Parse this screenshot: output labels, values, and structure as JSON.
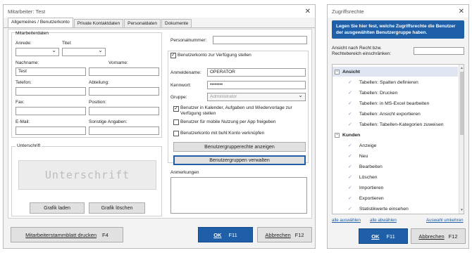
{
  "left": {
    "title": "Mitarbeiter: Test",
    "tabs": [
      "Allgemeines / Benutzerkonto",
      "Private Kontaktdaten",
      "Personaldaten",
      "Dokumente"
    ],
    "stamm_legend": "Mitarbeiterdaten",
    "anrede_label": "Anrede:",
    "titel_label": "Titel:",
    "nachname_label": "Nachname:",
    "nachname_value": "Test",
    "vorname_label": "Vorname:",
    "telefon_label": "Telefon:",
    "abteilung_label": "Abteilung:",
    "fax_label": "Fax:",
    "position_label": "Position:",
    "email_label": "E-Mail:",
    "sonstige_label": "Sonstige Angaben:",
    "unterschrift_legend": "Unterschrift",
    "signature_text": "Unterschrift",
    "grafik_laden": "Grafik laden",
    "grafik_loeschen": "Grafik löschen",
    "personalnummer_label": "Personalnummer:",
    "benutzerkonto_label": "Benutzerkonto zur Verfügung stellen",
    "anmeldename_label": "Anmeldename:",
    "anmeldename_value": "OPERATOR",
    "kennwort_label": "Kennwort:",
    "kennwort_value": "••••••••",
    "gruppe_label": "Gruppe:",
    "gruppe_value": "Administrator",
    "cb_kalender": "Benutzer in Kalender, Aufgaben und Wiedervorlage zur Verfügung stellen",
    "cb_mobile": "Benutzer für mobile Nutzung per App freigeben",
    "cb_buhl": "Benutzerkonto mit buhl:Konto verknüpfen",
    "btn_rechte": "Benutzergrupperechte anzeigen",
    "btn_verwalten": "Benutzergruppen verwalten",
    "anmerkungen_label": "Anmerkungen",
    "btn_drucken": "Mitarbeiterstammblatt drucken",
    "btn_drucken_key": "F4",
    "ok": "OK",
    "ok_key": "F11",
    "abbrechen": "Abbrechen",
    "abbrechen_key": "F12"
  },
  "right": {
    "title": "Zugriffsrechte",
    "banner": "Legen Sie hier fest, welche Zugriffsrechte die Benutzer der ausgewählten Benutzergruppe haben.",
    "filter_label": "Ansicht nach Recht bzw. Rechtebereich einschränken:",
    "items": [
      {
        "label": "Ansicht",
        "type": "group",
        "selected": true
      },
      {
        "label": "Tabellen: Spalten definieren",
        "type": "item"
      },
      {
        "label": "Tabellen: Drucken",
        "type": "item"
      },
      {
        "label": "Tabellen: in MS-Excel bearbeiten",
        "type": "item"
      },
      {
        "label": "Tabellen: Ansicht exportieren",
        "type": "item"
      },
      {
        "label": "Tabellen: Tabellen-Kategorien zuweisen",
        "type": "item"
      },
      {
        "label": "Kunden",
        "type": "group"
      },
      {
        "label": "Anzeige",
        "type": "item"
      },
      {
        "label": "Neu",
        "type": "item"
      },
      {
        "label": "Bearbeiten",
        "type": "item"
      },
      {
        "label": "Löschen",
        "type": "item"
      },
      {
        "label": "Importieren",
        "type": "item"
      },
      {
        "label": "Exportieren",
        "type": "item"
      },
      {
        "label": "Statistikwerte einsehen",
        "type": "item"
      }
    ],
    "alle_auswaehlen": "alle auswählen",
    "alle_abwaehlen": "alle abwählen",
    "auswahl_umkehren": "Auswahl umkehren",
    "ok": "OK",
    "ok_key": "F11",
    "abbrechen": "Abbrechen",
    "abbrechen_key": "F12"
  }
}
